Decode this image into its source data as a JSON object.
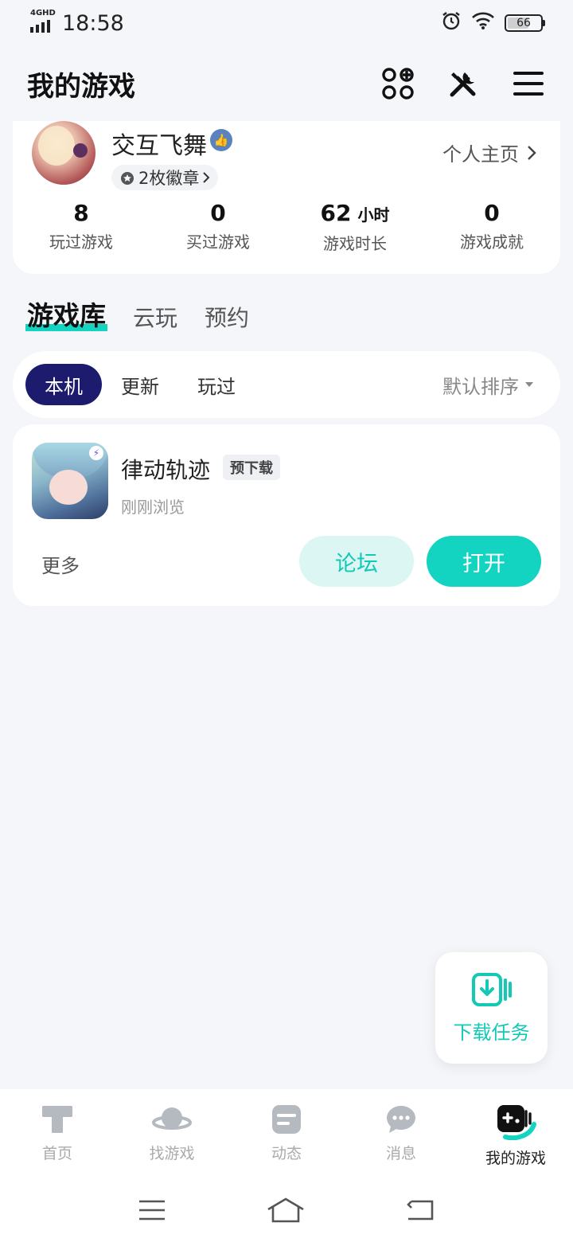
{
  "status_bar": {
    "time": "18:58",
    "network": "4GHD",
    "battery": "66",
    "battery_level": 0.66
  },
  "header": {
    "title": "我的游戏"
  },
  "profile": {
    "username": "交互飞舞",
    "badges": "2枚徽章",
    "profile_link": "个人主页",
    "stats": [
      {
        "value": "8",
        "unit": "",
        "label": "玩过游戏"
      },
      {
        "value": "0",
        "unit": "",
        "label": "买过游戏"
      },
      {
        "value": "62",
        "unit": "小时",
        "label": "游戏时长"
      },
      {
        "value": "0",
        "unit": "",
        "label": "游戏成就"
      }
    ]
  },
  "library_tabs": [
    {
      "label": "游戏库",
      "active": true
    },
    {
      "label": "云玩",
      "active": false
    },
    {
      "label": "预约",
      "active": false
    }
  ],
  "filter": {
    "chips": [
      {
        "label": "本机",
        "active": true
      },
      {
        "label": "更新",
        "active": false
      },
      {
        "label": "玩过",
        "active": false
      }
    ],
    "sort_label": "默认排序"
  },
  "game": {
    "name": "律动轨迹",
    "tag": "预下载",
    "subtitle": "刚刚浏览",
    "more_label": "更多",
    "forum_label": "论坛",
    "open_label": "打开"
  },
  "fab": {
    "label": "下载任务"
  },
  "bottom_nav": [
    {
      "label": "首页",
      "icon": "home-icon",
      "active": false
    },
    {
      "label": "找游戏",
      "icon": "planet-icon",
      "active": false
    },
    {
      "label": "动态",
      "icon": "feed-icon",
      "active": false
    },
    {
      "label": "消息",
      "icon": "message-icon",
      "active": false
    },
    {
      "label": "我的游戏",
      "icon": "gamepad-icon",
      "active": true
    }
  ],
  "colors": {
    "accent": "#13d3c1",
    "chip_active": "#1d1b6e",
    "background": "#f4f6f9"
  }
}
